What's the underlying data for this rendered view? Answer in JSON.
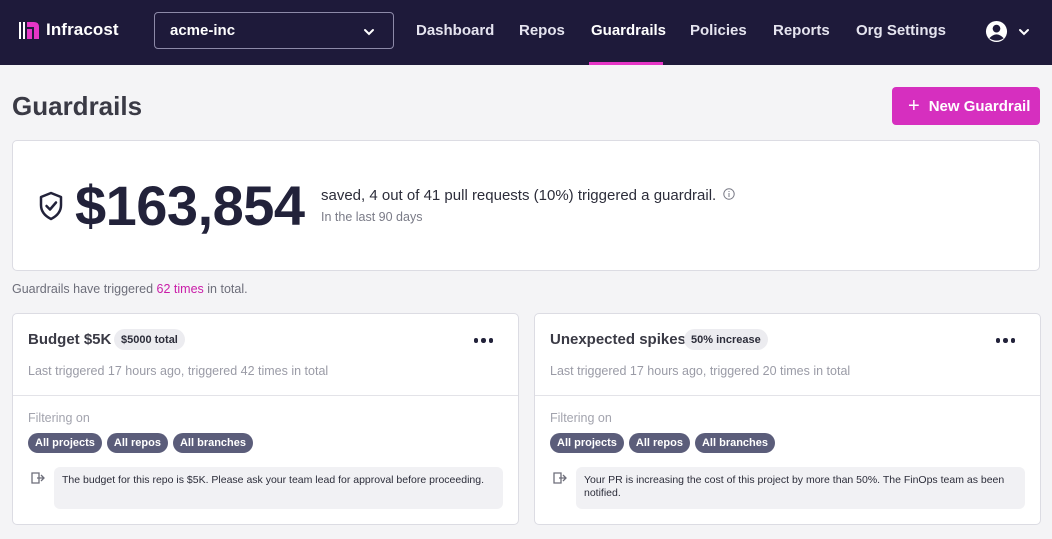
{
  "app": {
    "name": "Infracost"
  },
  "org_selector": {
    "value": "acme-inc"
  },
  "nav": {
    "items": [
      {
        "label": "Dashboard"
      },
      {
        "label": "Repos"
      },
      {
        "label": "Guardrails"
      },
      {
        "label": "Policies"
      },
      {
        "label": "Reports"
      },
      {
        "label": "Org Settings"
      }
    ],
    "active": "Guardrails"
  },
  "page": {
    "title": "Guardrails",
    "new_button_label": "New Guardrail"
  },
  "summary": {
    "amount": "$163,854",
    "text": "saved, 4 out of 41 pull requests (10%) triggered a guardrail.",
    "period": "In the last 90 days"
  },
  "triggered": {
    "prefix": "Guardrails have triggered",
    "count": "62 times",
    "suffix": "in total."
  },
  "guardrails": [
    {
      "name": "Budget $5K",
      "badge": "$5000 total",
      "last_triggered": "Last triggered 17 hours ago, triggered 42 times in total",
      "filter_label": "Filtering on",
      "tags": [
        "All projects",
        "All repos",
        "All branches"
      ],
      "message": "The budget for this repo is $5K. Please ask your team lead for approval before proceeding."
    },
    {
      "name": "Unexpected spikes",
      "badge": "50% increase",
      "last_triggered": "Last triggered 17 hours ago, triggered 20 times in total",
      "filter_label": "Filtering on",
      "tags": [
        "All projects",
        "All repos",
        "All branches"
      ],
      "message": "Your PR is increasing the cost of this project by more than 50%. The FinOps team as been notified."
    }
  ],
  "colors": {
    "nav_bg": "#1e1a3a",
    "accent": "#d62fbf",
    "tag_bg": "#5b5d7a"
  }
}
